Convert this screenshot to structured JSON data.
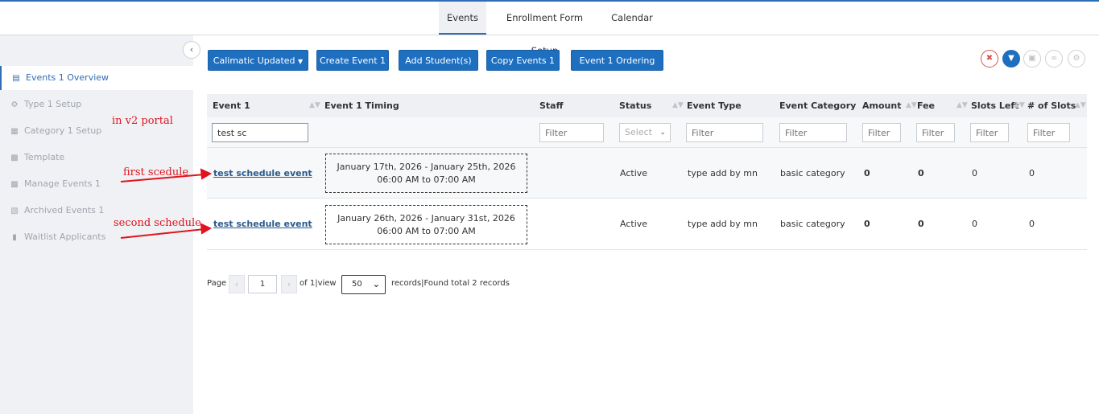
{
  "topnav": {
    "tabs": [
      {
        "label": "Events",
        "active": true
      },
      {
        "label": "Enrollment Form Setup",
        "active": false
      },
      {
        "label": "Calendar",
        "active": false
      }
    ]
  },
  "sidebar": {
    "collapse_icon": "chevron-left-icon",
    "items": [
      {
        "label": "Events 1 Overview",
        "icon": "list-icon",
        "active": true
      },
      {
        "label": "Type 1 Setup",
        "icon": "gear-icon"
      },
      {
        "label": "Category 1 Setup",
        "icon": "folder-icon"
      },
      {
        "label": "Template",
        "icon": "template-icon"
      },
      {
        "label": "Manage Events 1",
        "icon": "manage-icon"
      },
      {
        "label": "Archived Events 1",
        "icon": "archive-icon"
      },
      {
        "label": "Waitlist Applicants",
        "icon": "clipboard-icon"
      }
    ]
  },
  "toolbar": {
    "calimatic_label": "Calimatic Updated",
    "create_label": "Create Event 1",
    "add_students_label": "Add Student(s)",
    "copy_label": "Copy Events 1",
    "ordering_label": "Event 1 Ordering",
    "icons": [
      "clear-filter-icon",
      "filter-icon",
      "layout-icon",
      "share-icon",
      "settings-icon"
    ]
  },
  "grid": {
    "columns": [
      "Event 1",
      "Event 1 Timing",
      "Staff",
      "Status",
      "Event Type",
      "Event Category",
      "Amount",
      "Fee",
      "Slots Left",
      "# of Slots"
    ],
    "filters": {
      "event_value": "test sc",
      "placeholder": "Filter",
      "select_placeholder": "Select"
    },
    "rows": [
      {
        "event": "test schedule event",
        "timing_dates": "January 17th, 2026 - January 25th, 2026",
        "timing_times": "06:00 AM to 07:00 AM",
        "staff": "",
        "status": "Active",
        "type": "type add by mn",
        "category": "basic category",
        "amount": "0",
        "fee": "0",
        "slots_left": "0",
        "slots": "0"
      },
      {
        "event": "test schedule event",
        "timing_dates": "January 26th, 2026 - January 31st, 2026",
        "timing_times": "06:00 AM to 07:00 AM",
        "staff": "",
        "status": "Active",
        "type": "type add by mn",
        "category": "basic category",
        "amount": "0",
        "fee": "0",
        "slots_left": "0",
        "slots": "0"
      }
    ]
  },
  "pager": {
    "page_label": "Page",
    "page_value": "1",
    "of_label": "of 1",
    "view_label": "view",
    "page_size": "50",
    "records_label": "records",
    "found_label": "Found total 2 records"
  },
  "annotations": {
    "v2": "in v2 portal",
    "first": "first scedule",
    "second": "second schedule",
    "color": "#e0141e"
  },
  "colors": {
    "primary": "#1e6fc0",
    "sidebar_bg": "#f0f1f4",
    "danger": "#d9534f"
  }
}
